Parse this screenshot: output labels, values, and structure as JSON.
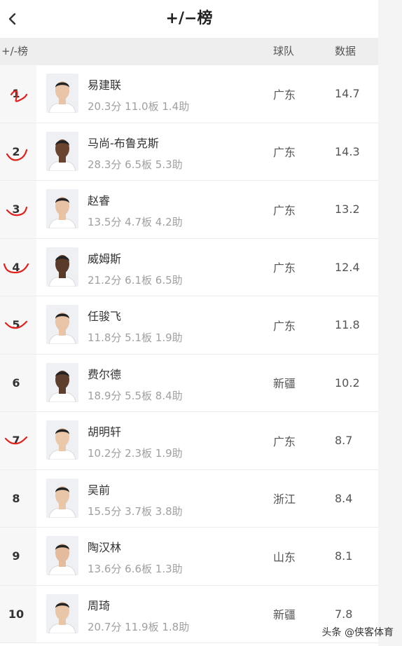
{
  "header": {
    "back_icon": "chevron-left-icon",
    "title": "+/−榜"
  },
  "columns": {
    "rank": "+/-榜",
    "team": "球队",
    "stat": "数据"
  },
  "players": [
    {
      "rank": "1",
      "name": "易建联",
      "stats": "20.3分 11.0板 1.4助",
      "team": "广东",
      "value": "14.7",
      "annotated": true
    },
    {
      "rank": "2",
      "name": "马尚-布鲁克斯",
      "stats": "28.3分 6.5板 5.3助",
      "team": "广东",
      "value": "14.3",
      "annotated": true
    },
    {
      "rank": "3",
      "name": "赵睿",
      "stats": "13.5分 4.7板 4.2助",
      "team": "广东",
      "value": "13.2",
      "annotated": true
    },
    {
      "rank": "4",
      "name": "威姆斯",
      "stats": "21.2分 6.1板 6.5助",
      "team": "广东",
      "value": "12.4",
      "annotated": true
    },
    {
      "rank": "5",
      "name": "任骏飞",
      "stats": "11.8分 5.1板 1.9助",
      "team": "广东",
      "value": "11.8",
      "annotated": true
    },
    {
      "rank": "6",
      "name": "费尔德",
      "stats": "18.9分 5.5板 8.4助",
      "team": "新疆",
      "value": "10.2",
      "annotated": false
    },
    {
      "rank": "7",
      "name": "胡明轩",
      "stats": "10.2分 2.3板 1.9助",
      "team": "广东",
      "value": "8.7",
      "annotated": true
    },
    {
      "rank": "8",
      "name": "吴前",
      "stats": "15.5分 3.7板 3.8助",
      "team": "浙江",
      "value": "8.4",
      "annotated": false
    },
    {
      "rank": "9",
      "name": "陶汉林",
      "stats": "13.6分 6.6板 1.3助",
      "team": "山东",
      "value": "8.1",
      "annotated": false
    },
    {
      "rank": "10",
      "name": "周琦",
      "stats": "20.7分 11.9板 1.8助",
      "team": "新疆",
      "value": "7.8",
      "annotated": false
    }
  ],
  "watermark": "头条 @侠客体育",
  "colors": {
    "annotation": "#e0201b",
    "header_bg": "#eeeeee",
    "rank_bg": "#f7f7f7"
  }
}
